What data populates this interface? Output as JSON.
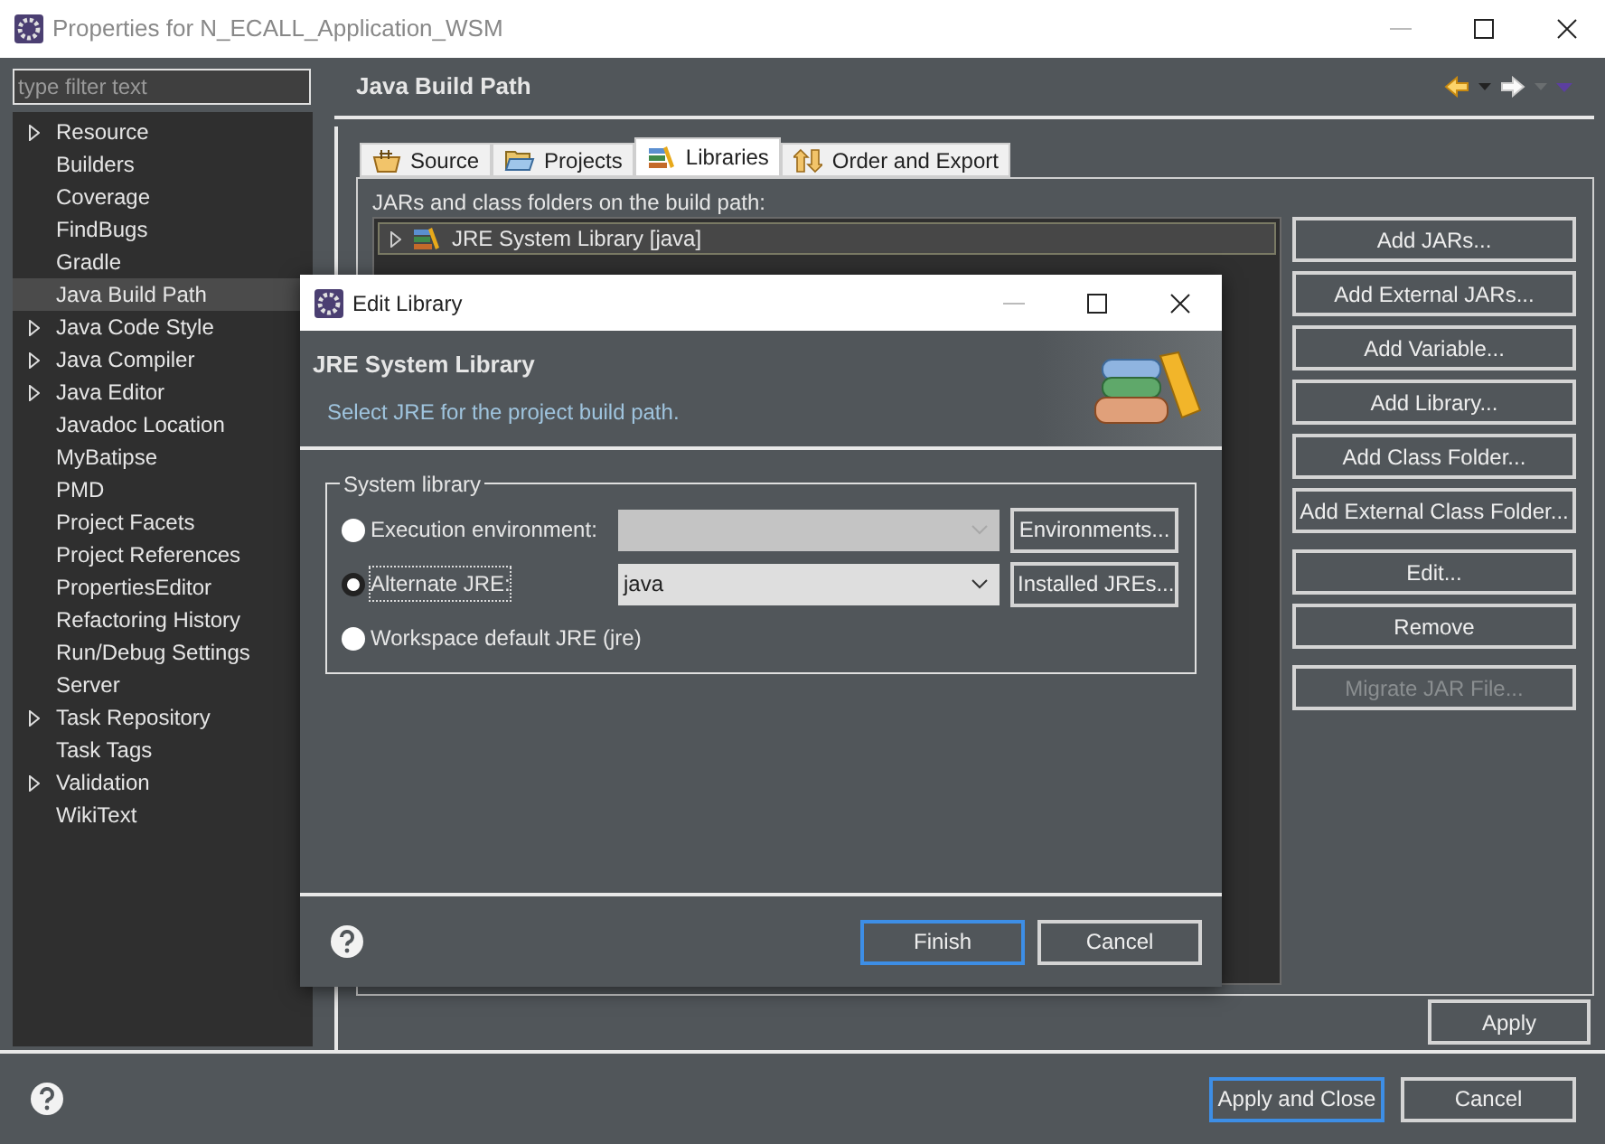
{
  "window": {
    "title": "Properties for N_ECALL_Application_WSM"
  },
  "filter": {
    "placeholder": "type filter text"
  },
  "tree": [
    {
      "label": "Resource",
      "expandable": true,
      "selected": false
    },
    {
      "label": "Builders",
      "expandable": false,
      "selected": false
    },
    {
      "label": "Coverage",
      "expandable": false,
      "selected": false
    },
    {
      "label": "FindBugs",
      "expandable": false,
      "selected": false
    },
    {
      "label": "Gradle",
      "expandable": false,
      "selected": false
    },
    {
      "label": "Java Build Path",
      "expandable": false,
      "selected": true
    },
    {
      "label": "Java Code Style",
      "expandable": true,
      "selected": false
    },
    {
      "label": "Java Compiler",
      "expandable": true,
      "selected": false
    },
    {
      "label": "Java Editor",
      "expandable": true,
      "selected": false
    },
    {
      "label": "Javadoc Location",
      "expandable": false,
      "selected": false
    },
    {
      "label": "MyBatipse",
      "expandable": false,
      "selected": false
    },
    {
      "label": "PMD",
      "expandable": false,
      "selected": false
    },
    {
      "label": "Project Facets",
      "expandable": false,
      "selected": false
    },
    {
      "label": "Project References",
      "expandable": false,
      "selected": false
    },
    {
      "label": "PropertiesEditor",
      "expandable": false,
      "selected": false
    },
    {
      "label": "Refactoring History",
      "expandable": false,
      "selected": false
    },
    {
      "label": "Run/Debug Settings",
      "expandable": false,
      "selected": false
    },
    {
      "label": "Server",
      "expandable": false,
      "selected": false
    },
    {
      "label": "Task Repository",
      "expandable": true,
      "selected": false
    },
    {
      "label": "Task Tags",
      "expandable": false,
      "selected": false
    },
    {
      "label": "Validation",
      "expandable": true,
      "selected": false
    },
    {
      "label": "WikiText",
      "expandable": false,
      "selected": false
    }
  ],
  "page": {
    "title": "Java Build Path",
    "tabs": [
      {
        "label": "Source",
        "kind": "source",
        "selected": false
      },
      {
        "label": "Projects",
        "kind": "projects",
        "selected": false
      },
      {
        "label": "Libraries",
        "kind": "libraries",
        "selected": true
      },
      {
        "label": "Order and Export",
        "kind": "order",
        "selected": false
      }
    ],
    "list_caption": "JARs and class folders on the build path:",
    "entries": [
      {
        "label": "JRE System Library [java]",
        "selected": true
      }
    ],
    "button_groups": [
      [
        {
          "label": "Add JARs...",
          "disabled": false
        },
        {
          "label": "Add External JARs...",
          "disabled": false
        },
        {
          "label": "Add Variable...",
          "disabled": false
        },
        {
          "label": "Add Library...",
          "disabled": false
        },
        {
          "label": "Add Class Folder...",
          "disabled": false
        },
        {
          "label": "Add External Class Folder...",
          "disabled": false
        }
      ],
      [
        {
          "label": "Edit...",
          "disabled": false
        },
        {
          "label": "Remove",
          "disabled": false
        }
      ],
      [
        {
          "label": "Migrate JAR File...",
          "disabled": true
        }
      ]
    ],
    "apply": "Apply"
  },
  "footer": {
    "buttons": [
      {
        "label": "Apply and Close",
        "default": true
      },
      {
        "label": "Cancel",
        "default": false
      }
    ]
  },
  "dialog": {
    "title": "Edit Library",
    "heading": "JRE System Library",
    "description": "Select JRE for the project build path.",
    "group": "System library",
    "options": [
      {
        "label": "Execution environment:",
        "selected": false,
        "combo": {
          "disabled": true
        },
        "button": "Environments..."
      },
      {
        "label": "Alternate JRE:",
        "selected": true,
        "combo": {
          "value": "java",
          "disabled": false
        },
        "button": "Installed JREs..."
      },
      {
        "label": "Workspace default JRE (jre)",
        "selected": false
      }
    ],
    "buttons": [
      {
        "label": "Finish",
        "default": true
      },
      {
        "label": "Cancel",
        "default": false
      }
    ]
  }
}
